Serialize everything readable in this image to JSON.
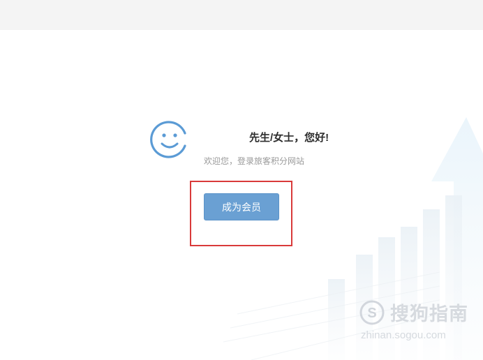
{
  "greeting": {
    "text": "先生/女士，您好!"
  },
  "welcome": {
    "text": "欢迎您，登录旅客积分网站"
  },
  "member_button": {
    "label": "成为会员"
  },
  "watermark": {
    "brand": "搜狗指南",
    "url": "zhinan.sogou.com",
    "logo_letter": "S"
  },
  "colors": {
    "top_bar": "#f4f4f4",
    "smiley_stroke": "#5b9bd5",
    "button_bg": "#6aa0d3",
    "highlight_border": "#d93a3a"
  },
  "icons": {
    "avatar": "smiley-face-icon"
  }
}
